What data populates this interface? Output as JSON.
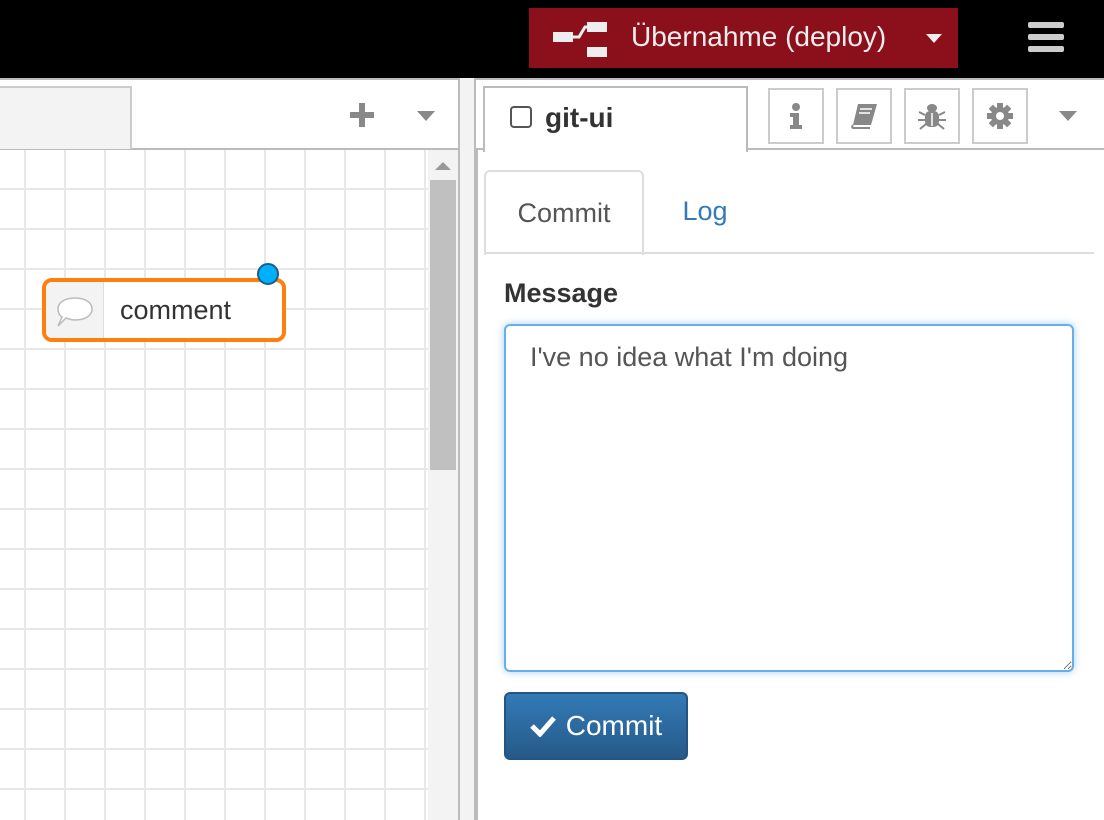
{
  "header": {
    "deploy_label": "Übernahme (deploy)",
    "deploy_color": "#8c101c",
    "menu_icon": "hamburger-icon"
  },
  "workspace": {
    "node": {
      "label": "comment",
      "type": "comment",
      "border_color": "#ff7f0e"
    }
  },
  "sidebar": {
    "tab_label": "git-ui",
    "buttons": [
      "info-icon",
      "book-icon",
      "bug-icon",
      "gear-icon"
    ],
    "inner_tabs": [
      {
        "label": "Commit",
        "active": true
      },
      {
        "label": "Log",
        "active": false
      }
    ],
    "message_label": "Message",
    "message_value": "I've no idea what I'm doing",
    "commit_label": "Commit"
  }
}
